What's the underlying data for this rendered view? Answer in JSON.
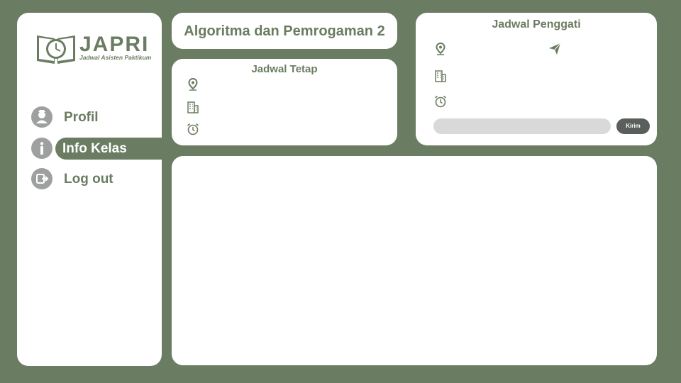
{
  "brand": {
    "name": "JAPRI",
    "tagline": "Jadwal Asisten Paktikum"
  },
  "sidebar": {
    "items": [
      {
        "label": "Profil",
        "icon": "user-icon",
        "active": false
      },
      {
        "label": "Info Kelas",
        "icon": "info-icon",
        "active": true
      },
      {
        "label": "Log out",
        "icon": "logout-icon",
        "active": false
      }
    ]
  },
  "course": {
    "title": "Algoritma dan Pemrogaman 2"
  },
  "fixed_schedule": {
    "title": "Jadwal Tetap",
    "icons": [
      "location-pin-icon",
      "building-icon",
      "alarm-clock-icon"
    ]
  },
  "replacement_schedule": {
    "title": "Jadwal Penggati",
    "icons": [
      "location-pin-icon",
      "send-icon",
      "building-icon",
      "alarm-clock-icon"
    ],
    "input_value": "",
    "send_label": "Kirim"
  },
  "colors": {
    "accent": "#6a7c62",
    "panel": "#ffffff",
    "icon_gray": "#9ea0a0",
    "button": "#5a5f5b",
    "input": "#d9d9d9"
  }
}
